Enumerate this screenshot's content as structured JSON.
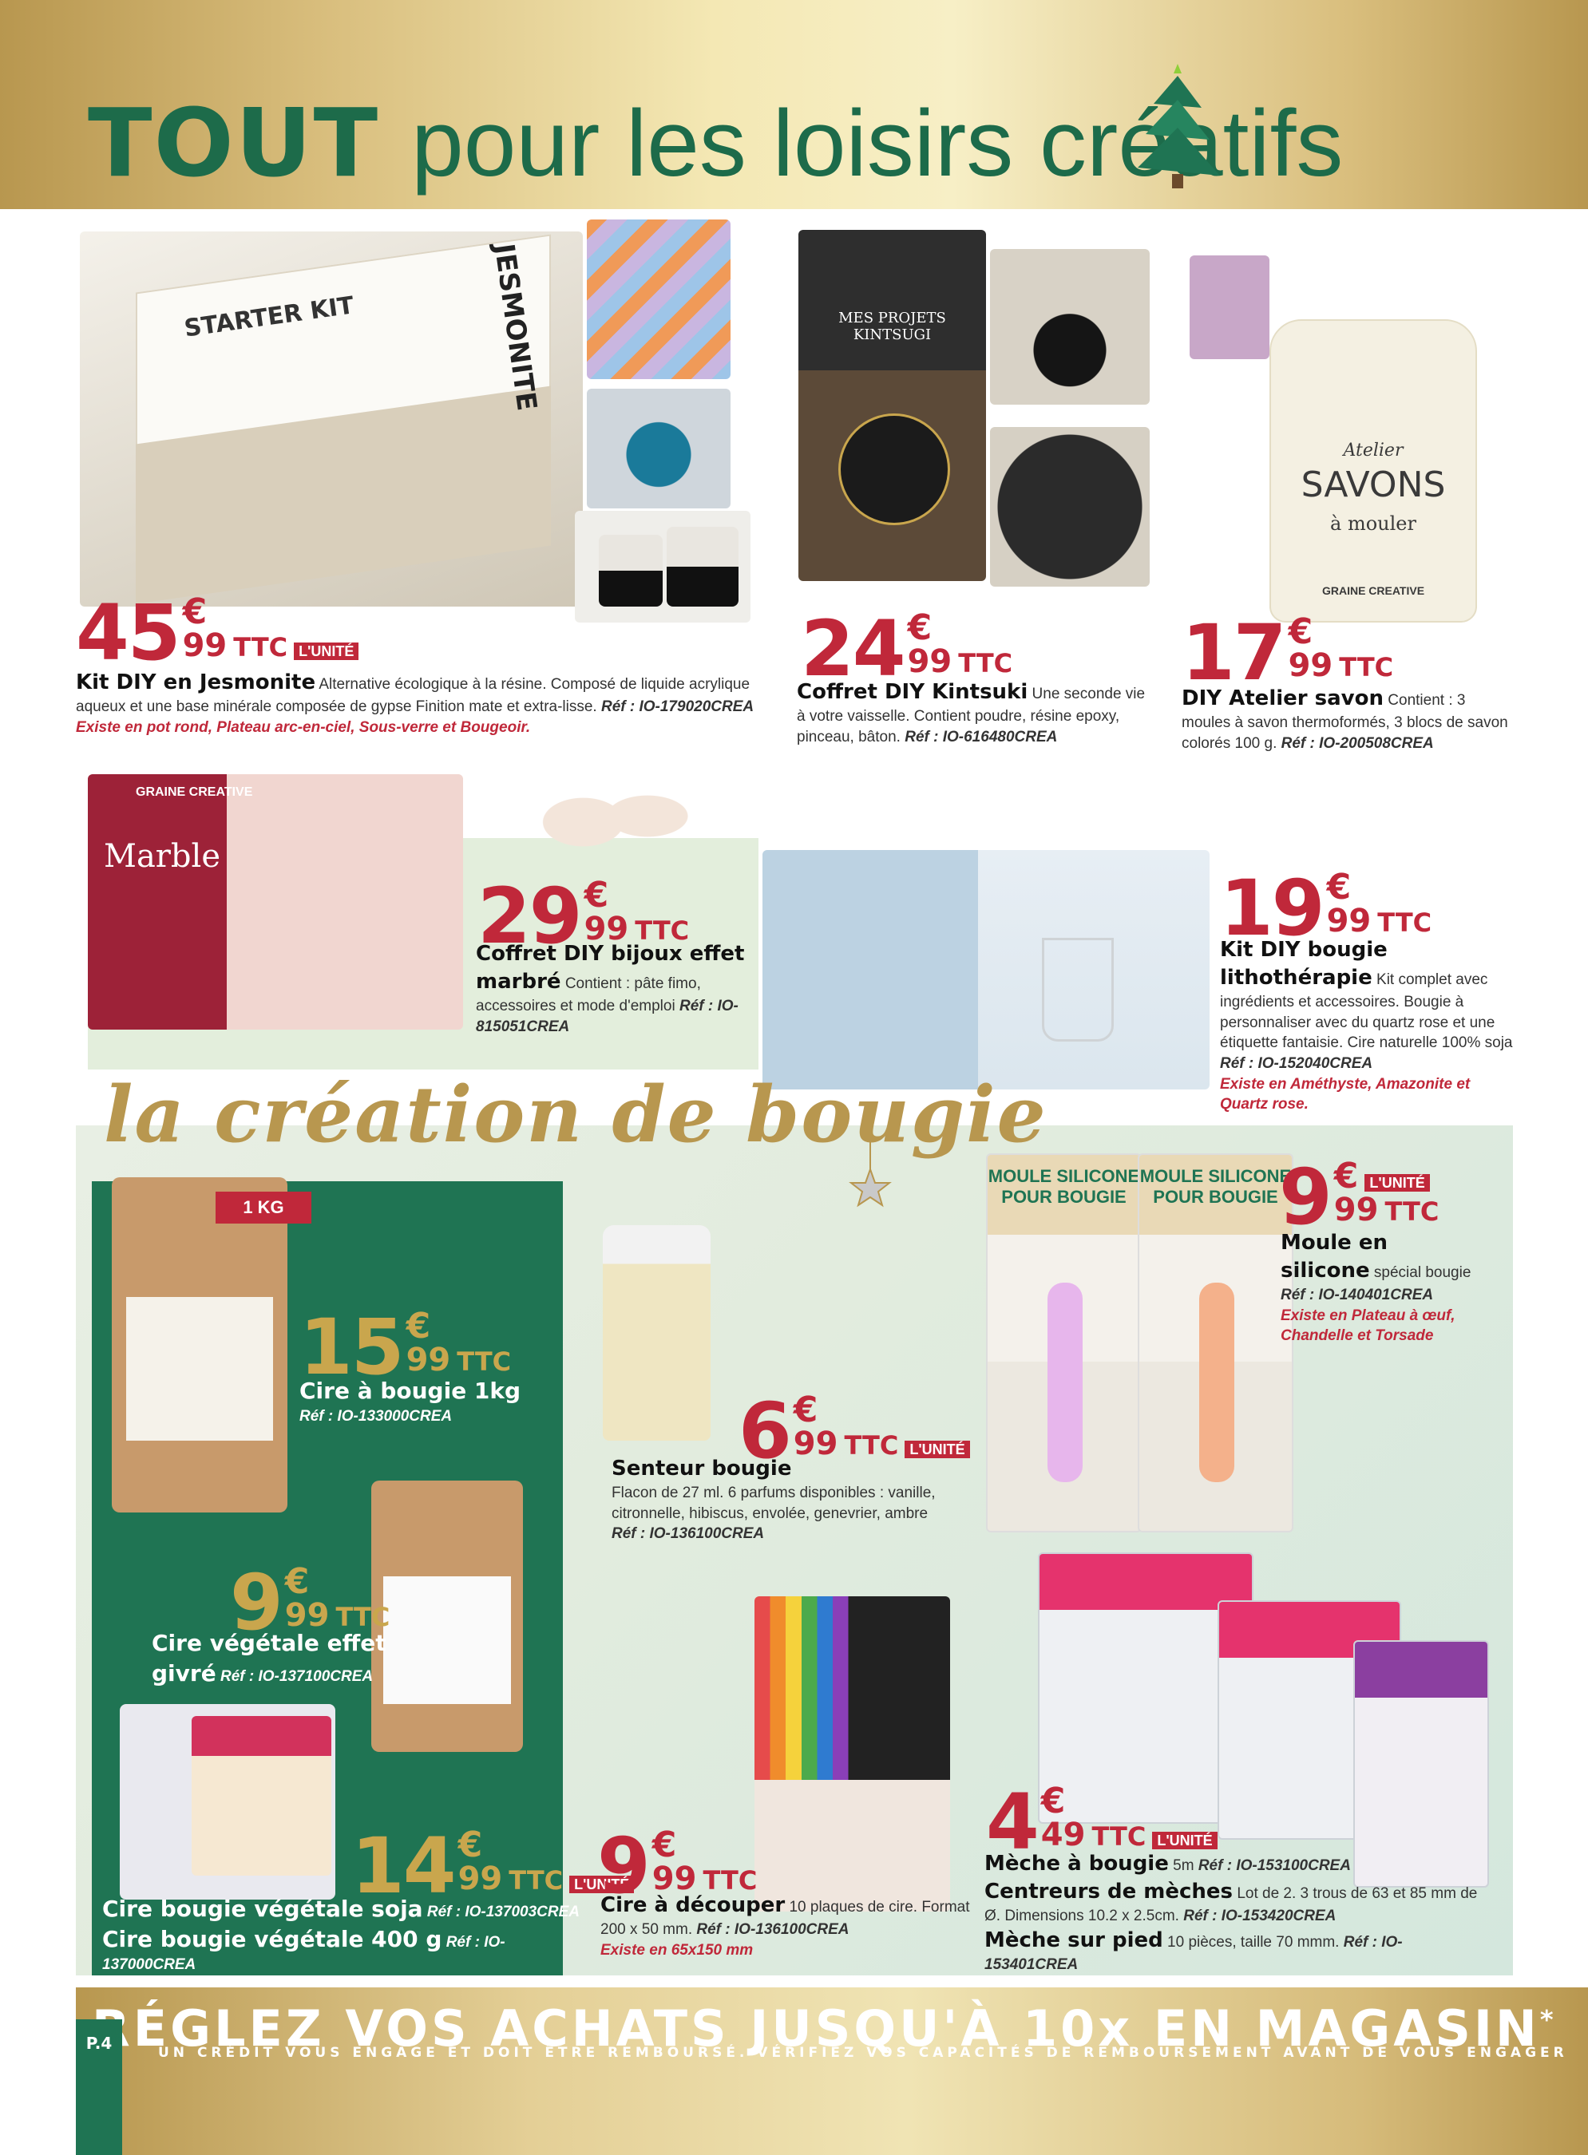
{
  "header": {
    "title_bold": "TOUT",
    "title_rest": "pour les loisirs créatifs"
  },
  "images": {
    "jesmonite_box": "STARTER KIT",
    "jesmonite_brand": "JESMONITE",
    "kintsugi_label": "MES PROJETS KINTSUGI",
    "bag_atelier": "Atelier",
    "bag_savons": "SAVONS",
    "bag_mouler": "à mouler",
    "bijoux_label": "Marble",
    "brand": "GRAINE CREATIVE",
    "kg_tag": "1 KG",
    "mould1": "MOULE SILICONE POUR BOUGIE",
    "mould2": "MOULE SILICONE POUR BOUGIE"
  },
  "products": {
    "jesmonite": {
      "price_int": "45",
      "price_euro": "€",
      "price_cents": "99",
      "ttc": "TTC",
      "unite": "L'UNITÉ",
      "name": "Kit DIY en Jesmonite",
      "desc": "Alternative écologique à la résine. Composé de liquide acrylique aqueux et une base minérale composée de gypse Finition mate et extra-lisse.",
      "ref": "Réf : IO-179020CREA",
      "extra": "Existe en pot rond, Plateau arc-en-ciel, Sous-verre et Bougeoir."
    },
    "kintsugi": {
      "price_int": "24",
      "price_euro": "€",
      "price_cents": "99",
      "ttc": "TTC",
      "name": "Coffret DIY Kintsuki",
      "desc": "Une seconde vie à votre vaisselle. Contient poudre, résine epoxy, pinceau, bâton.",
      "ref": "Réf : IO-616480CREA"
    },
    "savon": {
      "price_int": "17",
      "price_euro": "€",
      "price_cents": "99",
      "ttc": "TTC",
      "name": "DIY Atelier savon",
      "desc": "Contient : 3 moules à savon thermoformés, 3 blocs de savon colorés 100 g.",
      "ref": "Réf : IO-200508CREA"
    },
    "bijoux": {
      "price_int": "29",
      "price_euro": "€",
      "price_cents": "99",
      "ttc": "TTC",
      "name": "Coffret DIY bijoux effet marbré",
      "desc": "Contient : pâte fimo, accessoires et mode d'emploi",
      "ref": "Réf : IO-815051CREA"
    },
    "lithotherapie": {
      "price_int": "19",
      "price_euro": "€",
      "price_cents": "99",
      "ttc": "TTC",
      "name": "Kit DIY bougie lithothérapie",
      "desc": "Kit complet avec ingrédients et accessoires. Bougie à personnaliser avec du quartz rose et une étiquette fantaisie. Cire naturelle 100% soja",
      "ref": "Réf : IO-152040CREA",
      "extra": "Existe en Améthyste, Amazonite et Quartz rose."
    },
    "cire1kg": {
      "price_int": "15",
      "price_euro": "€",
      "price_cents": "99",
      "ttc": "TTC",
      "name": "Cire à bougie 1kg",
      "ref": "Réf : IO-133000CREA"
    },
    "senteur": {
      "price_int": "6",
      "price_euro": "€",
      "price_cents": "99",
      "ttc": "TTC",
      "unite": "L'UNITÉ",
      "name": "Senteur bougie",
      "desc": "Flacon de 27 ml. 6 parfums disponibles : vanille, citronnelle, hibiscus, envolée, genevrier, ambre",
      "ref": "Réf : IO-136100CREA"
    },
    "moule": {
      "price_int": "9",
      "price_euro": "€",
      "price_cents": "99",
      "ttc": "TTC",
      "unite": "L'UNITÉ",
      "name": "Moule en silicone",
      "desc": "spécial bougie",
      "ref": "Réf : IO-140401CREA",
      "extra": "Existe en Plateau à œuf, Chandelle et Torsade"
    },
    "givre": {
      "price_int": "9",
      "price_euro": "€",
      "price_cents": "99",
      "ttc": "TTC",
      "name": "Cire végétale effet givré",
      "ref": "Réf : IO-137100CREA"
    },
    "soja": {
      "price_int": "14",
      "price_euro": "€",
      "price_cents": "99",
      "ttc": "TTC",
      "unite": "L'UNITÉ",
      "name1": "Cire bougie végétale soja",
      "ref1": "Réf : IO-137003CREA",
      "name2": "Cire bougie végétale 400 g",
      "ref2": "Réf : IO-137000CREA"
    },
    "decouper": {
      "price_int": "9",
      "price_euro": "€",
      "price_cents": "99",
      "ttc": "TTC",
      "name": "Cire à découper",
      "desc": "10 plaques de cire. Format 200 x 50 mm.",
      "ref": "Réf : IO-136100CREA",
      "extra": "Existe en 65x150 mm"
    },
    "meche": {
      "price_int": "4",
      "price_euro": "€",
      "price_cents": "49",
      "ttc": "TTC",
      "unite": "L'UNITÉ",
      "name1": "Mèche à bougie",
      "desc1": "5m",
      "ref1": "Réf : IO-153100CREA",
      "name2": "Centreurs de mèches",
      "desc2": "Lot de 2. 3 trous de 63 et 85 mm de Ø. Dimensions 10.2 x 2.5cm.",
      "ref2": "Réf : IO-153420CREA",
      "name3": "Mèche sur pied",
      "desc3": "10 pièces, taille 70 mmm.",
      "ref3": "Réf : IO-153401CREA"
    }
  },
  "section": {
    "bougie_title": "la création de bougie"
  },
  "footer": {
    "title": "RÉGLEZ VOS ACHATS JUSQU'À 10x EN MAGASIN",
    "asterisk": "*",
    "subtitle": "UN CRÉDIT VOUS ENGAGE ET DOIT ÊTRE REMBOURSÉ. VÉRIFIEZ VOS CAPACITÉS DE REMBOURSEMENT AVANT DE VOUS ENGAGER",
    "page": "P.4"
  },
  "colors": {
    "green": "#1f7453",
    "red": "#c0283a",
    "gold": "#b8974f"
  }
}
